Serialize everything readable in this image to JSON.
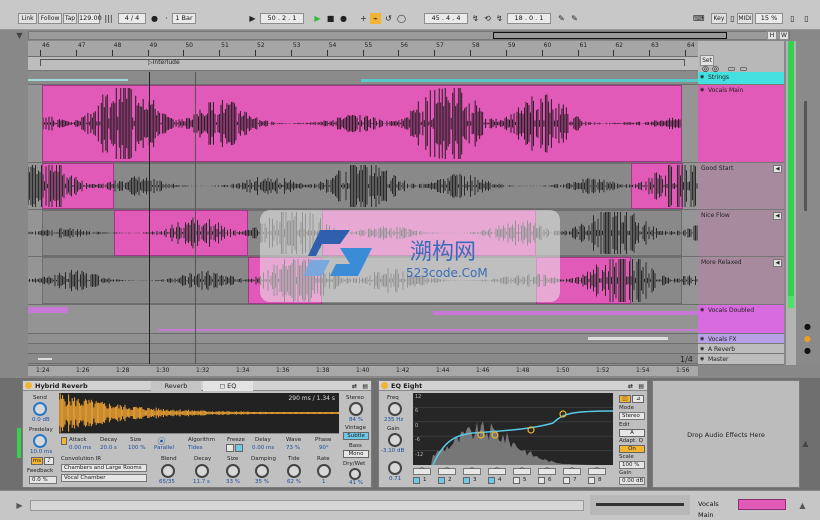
{
  "transport": {
    "link": "Link",
    "follow": "Follow",
    "tap": "Tap",
    "tempo": "129.00",
    "signature": "4 / 4",
    "quantize": "1 Bar",
    "arrangement_position": "50 . 2 . 1",
    "loop_start": "45 . 4 . 4",
    "loop_length": "18 . 0 . 1",
    "key": "Key",
    "midi": "MIDI",
    "cpu": "15 %",
    "h_btn": "H",
    "w_btn": "W"
  },
  "ruler": {
    "bars": [
      "46",
      "47",
      "48",
      "49",
      "50",
      "51",
      "52",
      "53",
      "54",
      "55",
      "56",
      "57",
      "58",
      "59",
      "60",
      "61",
      "62",
      "63",
      "64"
    ],
    "locator": "Interlude"
  },
  "time_ruler": {
    "times": [
      "1:24",
      "1:26",
      "1:28",
      "1:30",
      "1:32",
      "1:34",
      "1:36",
      "1:38",
      "1:40",
      "1:42",
      "1:44",
      "1:46",
      "1:48",
      "1:50",
      "1:52",
      "1:54",
      "1:56"
    ],
    "zoom": "1/4"
  },
  "tracks": [
    {
      "name": "Strings",
      "color": "#44e0e0"
    },
    {
      "name": "Vocals Main",
      "color": "#e25ab8"
    },
    {
      "name": "Good Start",
      "color": "#a57a98"
    },
    {
      "name": "Nice Flow",
      "color": "#a57a98"
    },
    {
      "name": "More Relaxed",
      "color": "#a57a98"
    },
    {
      "name": "Vocals Doubled",
      "color": "#d96be0"
    },
    {
      "name": "Vocals FX",
      "color": "#b8a0e6"
    },
    {
      "name": "A Reverb",
      "color": "#bdbdbd"
    },
    {
      "name": "Master",
      "color": "#bdbdbd"
    }
  ],
  "set_label": "Set",
  "reverb": {
    "title": "Hybrid Reverb",
    "tab_reverb": "Reverb",
    "tab_eq": "EQ",
    "send_label": "Send",
    "send_value": "0.0 dB",
    "predelay_label": "Predelay",
    "predelay_value": "10.0 ms",
    "ms_btn": "ms",
    "feedback_label": "Feedback",
    "feedback_value": "0.0 %",
    "ir_info": "290 ms / 1.34 s",
    "attack_label": "Attack",
    "attack_value": "0.00 ms",
    "decay_label": "Decay",
    "decay_value": "20.0 s",
    "size_label": "Size",
    "size_value": "100 %",
    "routing_value": "Parallel",
    "algorithm_label": "Algorithm",
    "algorithm_value": "Tides",
    "freeze_label": "Freeze",
    "delay_label": "Delay",
    "delay_value": "0.00 ms",
    "wave_label": "Wave",
    "wave_value": "73 %",
    "phase_label": "Phase",
    "phase_value": "90°",
    "convolution_label": "Convolution IR",
    "ir_category": "Chambers and Large Rooms",
    "ir_name": "Vocal Chamber",
    "blend_label": "Blend",
    "blend_value": "65/35",
    "decay2_label": "Decay",
    "decay2_value": "11.7 s",
    "size2_label": "Size",
    "size2_value": "33 %",
    "damping_label": "Damping",
    "damping_value": "35 %",
    "tide_label": "Tide",
    "tide_value": "62 %",
    "rate_label": "Rate",
    "rate_value": "1",
    "stereo_label": "Stereo",
    "stereo_value": "84 %",
    "vintage_label": "Vintage",
    "vintage_value": "Subtle",
    "bass_label": "Bass",
    "bass_value": "Mono",
    "drywet_label": "Dry/Wet",
    "drywet_value": "41 %"
  },
  "eq": {
    "title": "EQ Eight",
    "freq_label": "Freq",
    "freq_value": "235 Hz",
    "gain_label": "Gain",
    "gain_value": "-3.10 dB",
    "q_value": "0.71",
    "db_scale": [
      "12",
      "6",
      "0",
      "-6",
      "-12"
    ],
    "bands": [
      "1",
      "2",
      "3",
      "4",
      "5",
      "6",
      "7",
      "8"
    ],
    "mode_label": "Mode",
    "mode_value": "Stereo",
    "edit_label": "Edit",
    "edit_value": "A",
    "adapt_label": "Adapt. Q",
    "adapt_value": "On",
    "scale_label": "Scale",
    "scale_value": "100 %",
    "gain_out_label": "Gain",
    "gain_out_value": "0.00 dB"
  },
  "drop_text": "Drop Audio Effects Here",
  "bottom": {
    "track_name": "Vocals Main"
  },
  "watermark": {
    "line1": "溯构网",
    "line2": "523code.CoM"
  }
}
